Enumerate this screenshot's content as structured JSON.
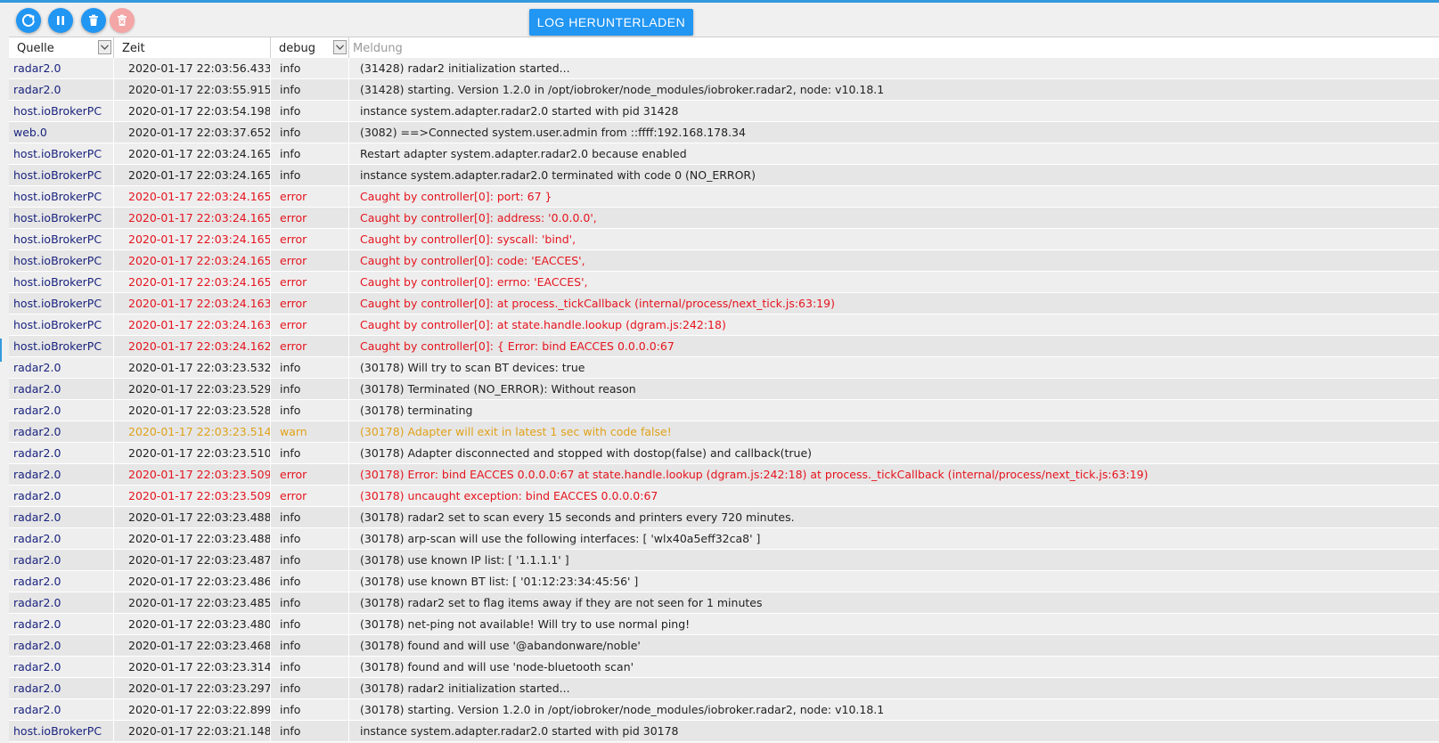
{
  "toolbar": {
    "download_label": "LOG HERUNTERLADEN",
    "icons": [
      "refresh-icon",
      "pause-icon",
      "delete-icon",
      "clear-icon"
    ],
    "accent_color": "#2196f3"
  },
  "filters": {
    "source_label": "Quelle",
    "time_label": "Zeit",
    "level_value": "debug",
    "message_placeholder": "Meldung"
  },
  "colors": {
    "error": "#e5141e",
    "warn": "#e0a21a",
    "source": "#1a237e"
  },
  "rows": [
    {
      "source": "radar2.0",
      "time": "2020-01-17 22:03:56.433",
      "severity": "info",
      "message": "(31428) radar2 initialization started..."
    },
    {
      "source": "radar2.0",
      "time": "2020-01-17 22:03:55.915",
      "severity": "info",
      "message": "(31428) starting. Version 1.2.0 in /opt/iobroker/node_modules/iobroker.radar2, node: v10.18.1"
    },
    {
      "source": "host.ioBrokerPC",
      "time": "2020-01-17 22:03:54.198",
      "severity": "info",
      "message": "instance system.adapter.radar2.0 started with pid 31428"
    },
    {
      "source": "web.0",
      "time": "2020-01-17 22:03:37.652",
      "severity": "info",
      "message": "(3082) ==>Connected system.user.admin from ::ffff:192.168.178.34"
    },
    {
      "source": "host.ioBrokerPC",
      "time": "2020-01-17 22:03:24.165",
      "severity": "info",
      "message": "Restart adapter system.adapter.radar2.0 because enabled"
    },
    {
      "source": "host.ioBrokerPC",
      "time": "2020-01-17 22:03:24.165",
      "severity": "info",
      "message": "instance system.adapter.radar2.0 terminated with code 0 (NO_ERROR)"
    },
    {
      "source": "host.ioBrokerPC",
      "time": "2020-01-17 22:03:24.165",
      "severity": "error",
      "message": "Caught by controller[0]: port: 67 }"
    },
    {
      "source": "host.ioBrokerPC",
      "time": "2020-01-17 22:03:24.165",
      "severity": "error",
      "message": "Caught by controller[0]: address: '0.0.0.0',"
    },
    {
      "source": "host.ioBrokerPC",
      "time": "2020-01-17 22:03:24.165",
      "severity": "error",
      "message": "Caught by controller[0]: syscall: 'bind',"
    },
    {
      "source": "host.ioBrokerPC",
      "time": "2020-01-17 22:03:24.165",
      "severity": "error",
      "message": "Caught by controller[0]: code: 'EACCES',"
    },
    {
      "source": "host.ioBrokerPC",
      "time": "2020-01-17 22:03:24.165",
      "severity": "error",
      "message": "Caught by controller[0]: errno: 'EACCES',"
    },
    {
      "source": "host.ioBrokerPC",
      "time": "2020-01-17 22:03:24.163",
      "severity": "error",
      "message": "Caught by controller[0]: at process._tickCallback (internal/process/next_tick.js:63:19)"
    },
    {
      "source": "host.ioBrokerPC",
      "time": "2020-01-17 22:03:24.163",
      "severity": "error",
      "message": "Caught by controller[0]: at state.handle.lookup (dgram.js:242:18)"
    },
    {
      "source": "host.ioBrokerPC",
      "time": "2020-01-17 22:03:24.162",
      "severity": "error",
      "message": "Caught by controller[0]: { Error: bind EACCES 0.0.0.0:67"
    },
    {
      "source": "radar2.0",
      "time": "2020-01-17 22:03:23.532",
      "severity": "info",
      "message": "(30178) Will try to scan BT devices: true"
    },
    {
      "source": "radar2.0",
      "time": "2020-01-17 22:03:23.529",
      "severity": "info",
      "message": "(30178) Terminated (NO_ERROR): Without reason"
    },
    {
      "source": "radar2.0",
      "time": "2020-01-17 22:03:23.528",
      "severity": "info",
      "message": "(30178) terminating"
    },
    {
      "source": "radar2.0",
      "time": "2020-01-17 22:03:23.514",
      "severity": "warn",
      "message": "(30178) Adapter will exit in latest 1 sec with code false!"
    },
    {
      "source": "radar2.0",
      "time": "2020-01-17 22:03:23.510",
      "severity": "info",
      "message": "(30178) Adapter disconnected and stopped with dostop(false) and callback(true)"
    },
    {
      "source": "radar2.0",
      "time": "2020-01-17 22:03:23.509",
      "severity": "error",
      "message": "(30178) Error: bind EACCES 0.0.0.0:67 at state.handle.lookup (dgram.js:242:18) at process._tickCallback (internal/process/next_tick.js:63:19)"
    },
    {
      "source": "radar2.0",
      "time": "2020-01-17 22:03:23.509",
      "severity": "error",
      "message": "(30178) uncaught exception: bind EACCES 0.0.0.0:67"
    },
    {
      "source": "radar2.0",
      "time": "2020-01-17 22:03:23.488",
      "severity": "info",
      "message": "(30178) radar2 set to scan every 15 seconds and printers every 720 minutes."
    },
    {
      "source": "radar2.0",
      "time": "2020-01-17 22:03:23.488",
      "severity": "info",
      "message": "(30178) arp-scan will use the following interfaces: [ 'wlx40a5eff32ca8' ]"
    },
    {
      "source": "radar2.0",
      "time": "2020-01-17 22:03:23.487",
      "severity": "info",
      "message": "(30178) use known IP list: [ '1.1.1.1' ]"
    },
    {
      "source": "radar2.0",
      "time": "2020-01-17 22:03:23.486",
      "severity": "info",
      "message": "(30178) use known BT list: [ '01:12:23:34:45:56' ]"
    },
    {
      "source": "radar2.0",
      "time": "2020-01-17 22:03:23.485",
      "severity": "info",
      "message": "(30178) radar2 set to flag items away if they are not seen for 1 minutes"
    },
    {
      "source": "radar2.0",
      "time": "2020-01-17 22:03:23.480",
      "severity": "info",
      "message": "(30178) net-ping not available! Will try to use normal ping!"
    },
    {
      "source": "radar2.0",
      "time": "2020-01-17 22:03:23.468",
      "severity": "info",
      "message": "(30178) found and will use '@abandonware/noble'"
    },
    {
      "source": "radar2.0",
      "time": "2020-01-17 22:03:23.314",
      "severity": "info",
      "message": "(30178) found and will use 'node-bluetooth scan'"
    },
    {
      "source": "radar2.0",
      "time": "2020-01-17 22:03:23.297",
      "severity": "info",
      "message": "(30178) radar2 initialization started..."
    },
    {
      "source": "radar2.0",
      "time": "2020-01-17 22:03:22.899",
      "severity": "info",
      "message": "(30178) starting. Version 1.2.0 in /opt/iobroker/node_modules/iobroker.radar2, node: v10.18.1"
    },
    {
      "source": "host.ioBrokerPC",
      "time": "2020-01-17 22:03:21.148",
      "severity": "info",
      "message": "instance system.adapter.radar2.0 started with pid 30178"
    }
  ]
}
